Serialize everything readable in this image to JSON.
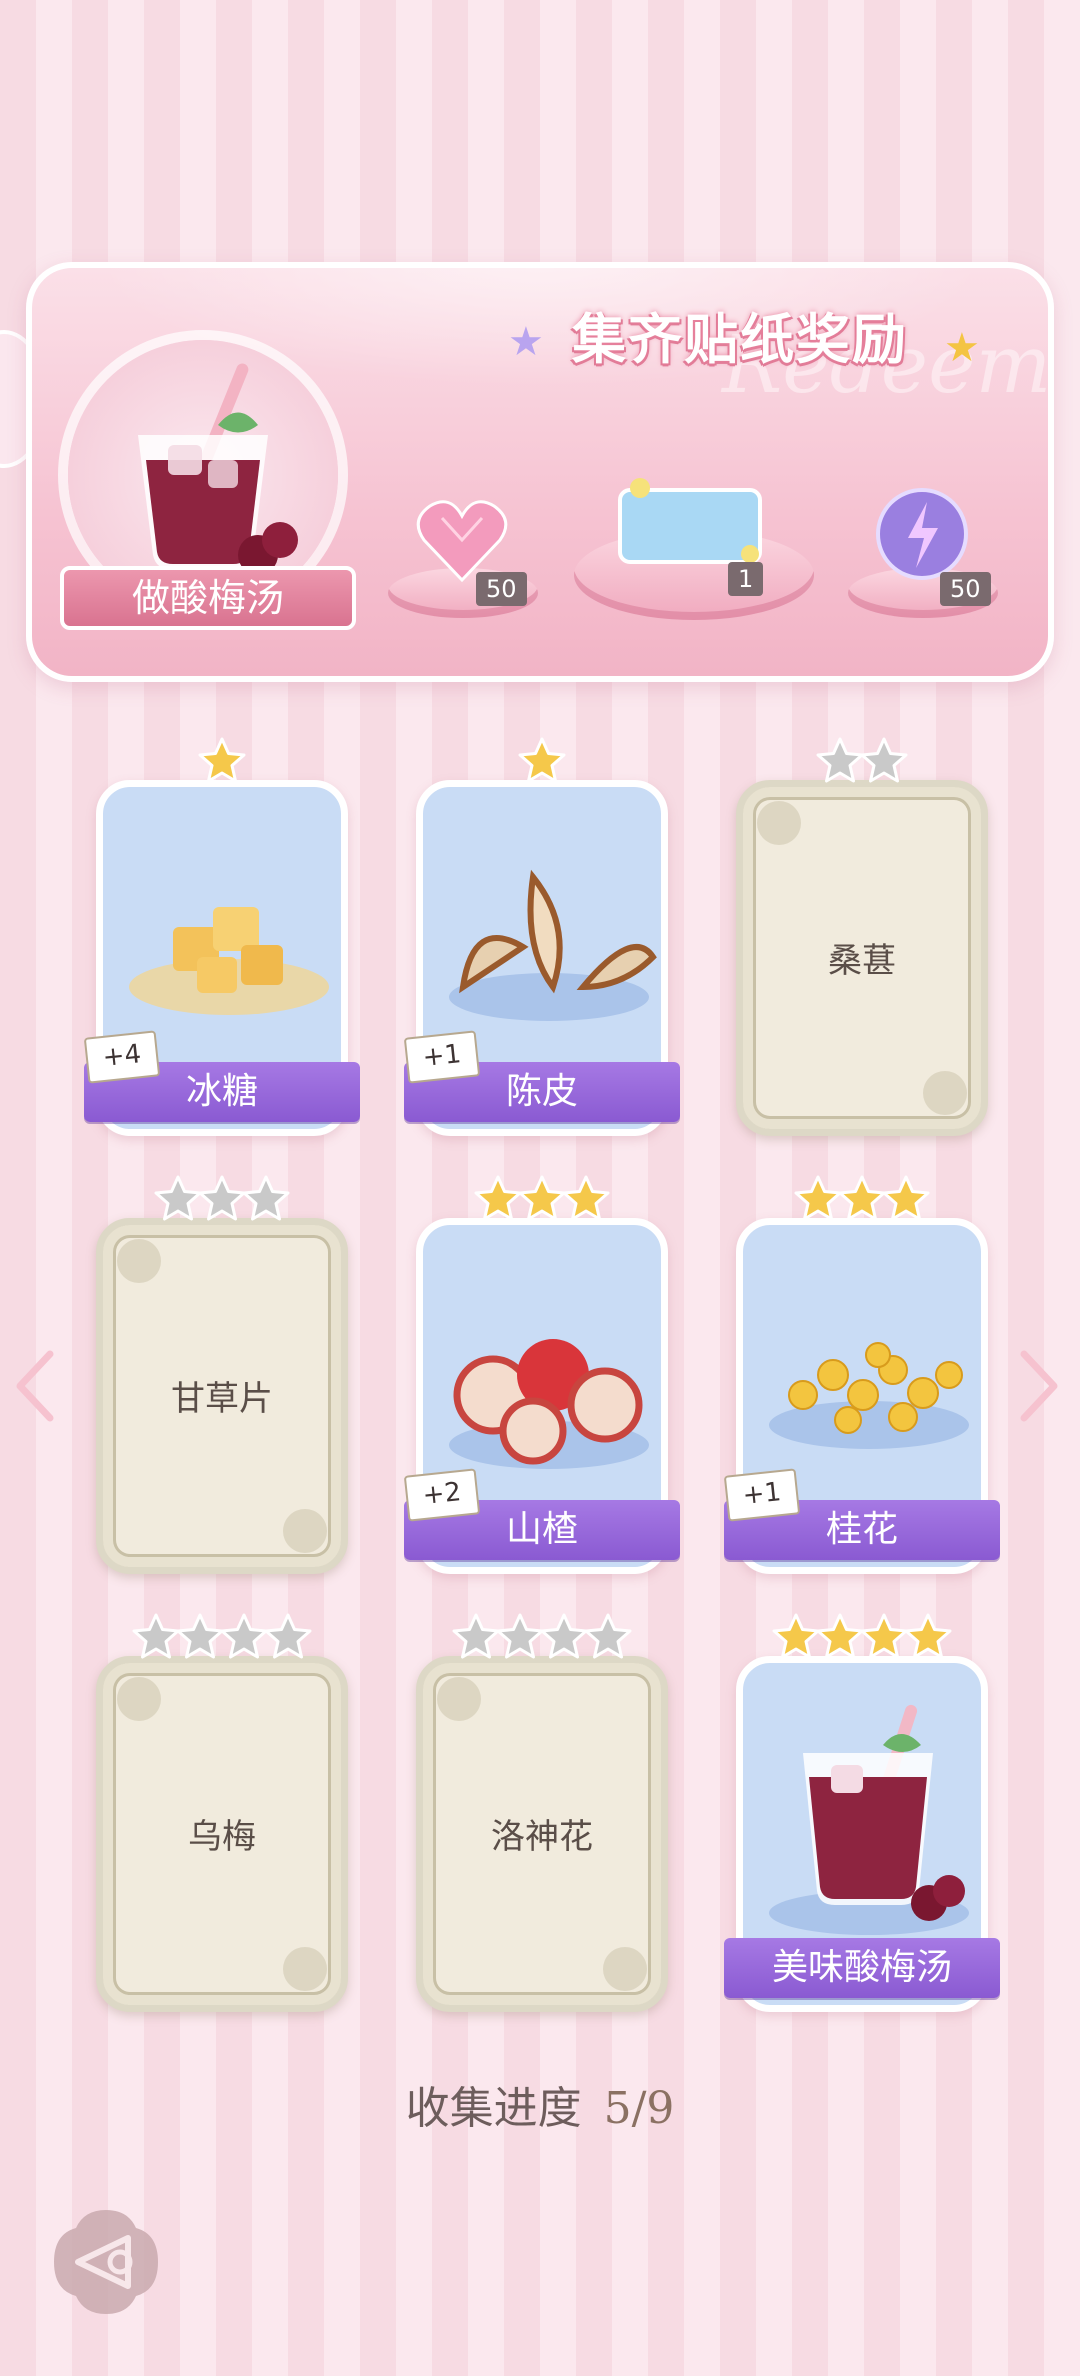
{
  "reward_banner": {
    "title": "集齐贴纸奖励",
    "watermark": "Redeem",
    "dish_name": "做酸梅汤",
    "rewards": [
      {
        "icon": "pink-heart-gem-icon",
        "count": "50"
      },
      {
        "icon": "sticker-card-icon",
        "count": "1"
      },
      {
        "icon": "lightning-orb-icon",
        "count": "50"
      }
    ]
  },
  "cards": [
    {
      "name": "冰糖",
      "stars": 1,
      "unlocked": true,
      "bonus": "+4",
      "icon": "rock-sugar-icon"
    },
    {
      "name": "陈皮",
      "stars": 1,
      "unlocked": true,
      "bonus": "+1",
      "icon": "dried-peel-icon"
    },
    {
      "name": "桑葚",
      "stars": 2,
      "unlocked": false,
      "bonus": "",
      "icon": ""
    },
    {
      "name": "甘草片",
      "stars": 3,
      "unlocked": false,
      "bonus": "",
      "icon": ""
    },
    {
      "name": "山楂",
      "stars": 3,
      "unlocked": true,
      "bonus": "+2",
      "icon": "hawthorn-icon"
    },
    {
      "name": "桂花",
      "stars": 3,
      "unlocked": true,
      "bonus": "+1",
      "icon": "osmanthus-icon"
    },
    {
      "name": "乌梅",
      "stars": 4,
      "unlocked": false,
      "bonus": "",
      "icon": ""
    },
    {
      "name": "洛神花",
      "stars": 4,
      "unlocked": false,
      "bonus": "",
      "icon": ""
    },
    {
      "name": "美味酸梅汤",
      "stars": 4,
      "unlocked": true,
      "bonus": "",
      "icon": "plum-drink-icon"
    }
  ],
  "progress": {
    "label": "收集进度",
    "value": "5/9"
  },
  "colors": {
    "star_gold": "#f5c84a",
    "star_gray": "#c9c9c9",
    "ribbon_purple": "#9466da",
    "banner_pink": "#f4bccc"
  }
}
